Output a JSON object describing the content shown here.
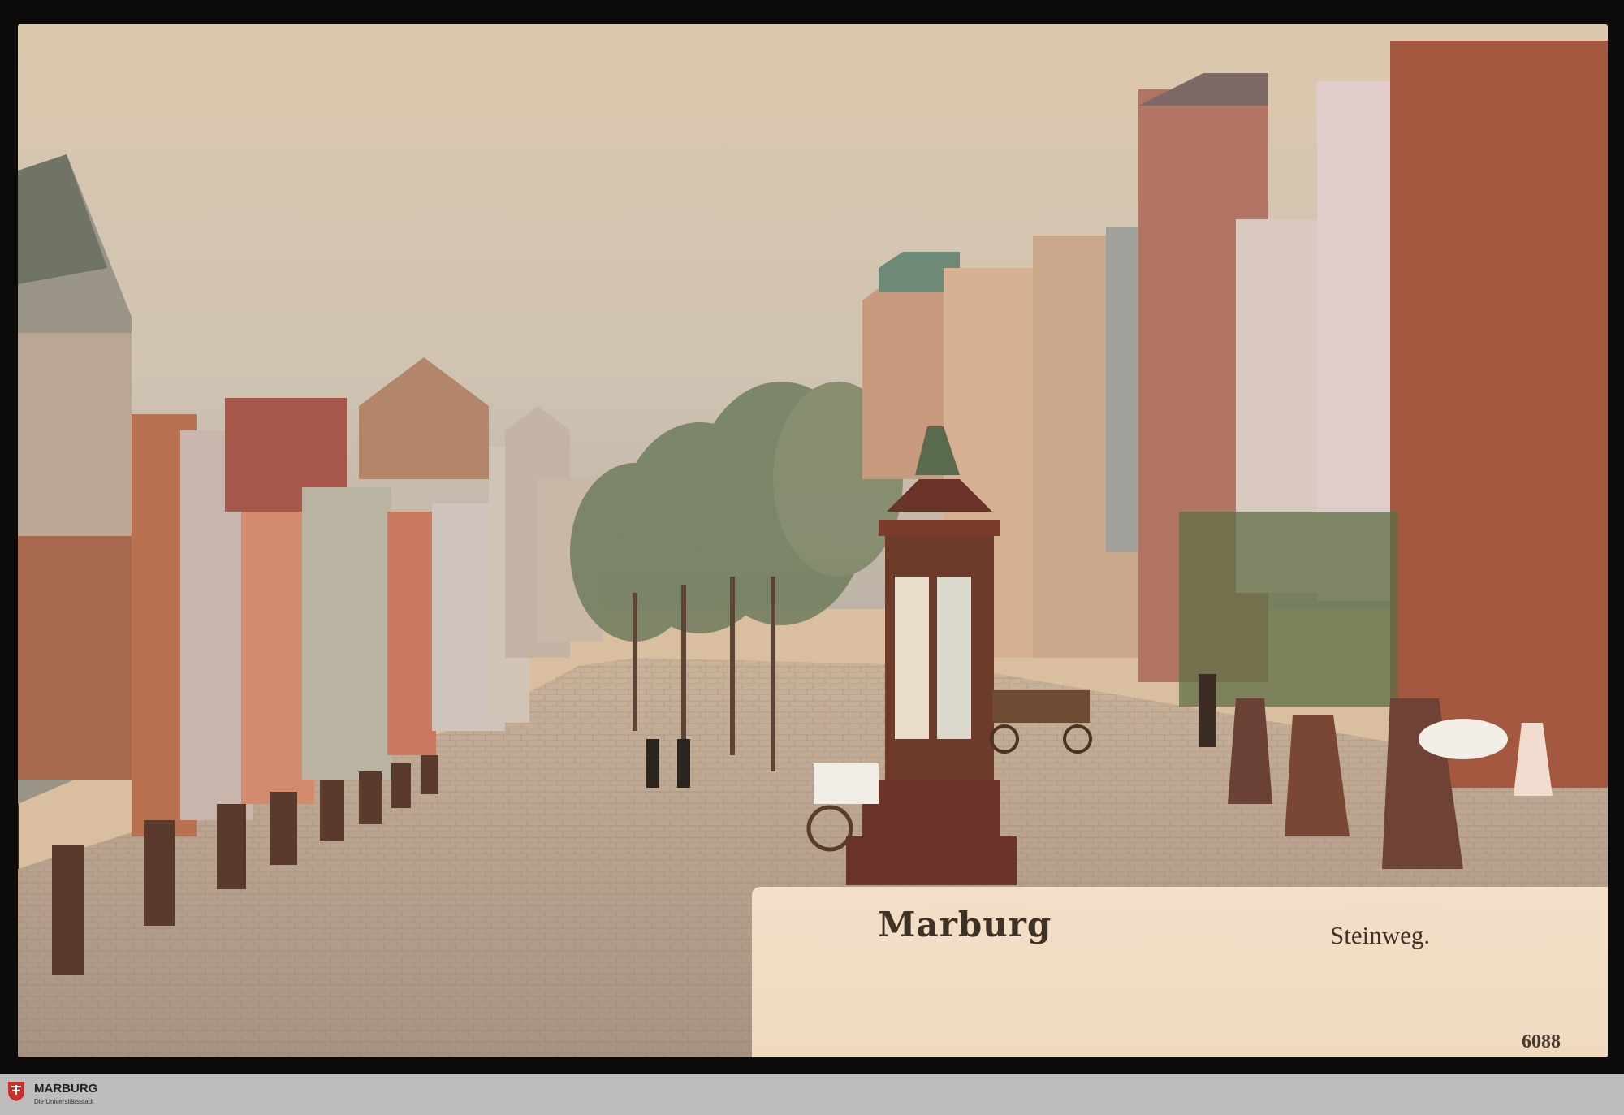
{
  "postcard": {
    "city_title": "Marburg",
    "street_title": "Steinweg.",
    "card_number": "6088",
    "colors": {
      "sky": "#d8c2a6",
      "paper": "#f0d9c0",
      "street": "#b8a08a",
      "trees": "#6f7d5e",
      "ink": "#3e3126"
    }
  },
  "footer": {
    "logo_title": "MARBURG",
    "logo_subtitle": "Die Universitätsstadt",
    "logo_icon": "city-crest-icon",
    "bar_color": "#bdbdbd",
    "crest_color": "#c8312b"
  }
}
